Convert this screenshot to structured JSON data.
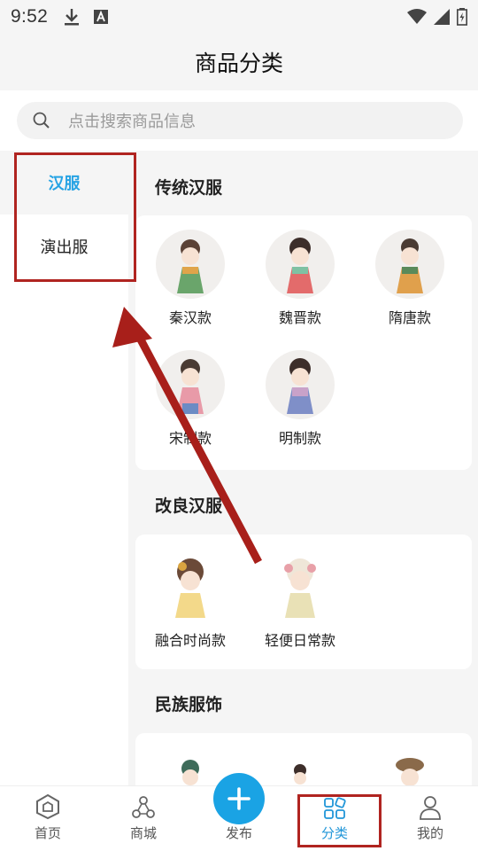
{
  "status_bar": {
    "time": "9:52"
  },
  "header": {
    "title": "商品分类"
  },
  "search": {
    "placeholder": "点击搜索商品信息"
  },
  "sidebar": {
    "items": [
      {
        "label": "汉服",
        "active": true
      },
      {
        "label": "演出服",
        "active": false
      }
    ]
  },
  "sections": [
    {
      "title": "传统汉服",
      "products": [
        {
          "name": "秦汉款"
        },
        {
          "name": "魏晋款"
        },
        {
          "name": "隋唐款"
        },
        {
          "name": "宋制款"
        },
        {
          "name": "明制款"
        }
      ]
    },
    {
      "title": "改良汉服",
      "products": [
        {
          "name": "融合时尚款"
        },
        {
          "name": "轻便日常款"
        }
      ]
    },
    {
      "title": "民族服饰",
      "products": []
    }
  ],
  "bottom_nav": {
    "items": [
      {
        "label": "首页",
        "icon": "home-icon"
      },
      {
        "label": "商城",
        "icon": "mall-icon"
      },
      {
        "label": "发布",
        "icon": "publish-icon"
      },
      {
        "label": "分类",
        "icon": "category-icon",
        "active": true
      },
      {
        "label": "我的",
        "icon": "profile-icon"
      }
    ]
  },
  "colors": {
    "accent": "#27a3e4",
    "annotation": "#b02420"
  }
}
